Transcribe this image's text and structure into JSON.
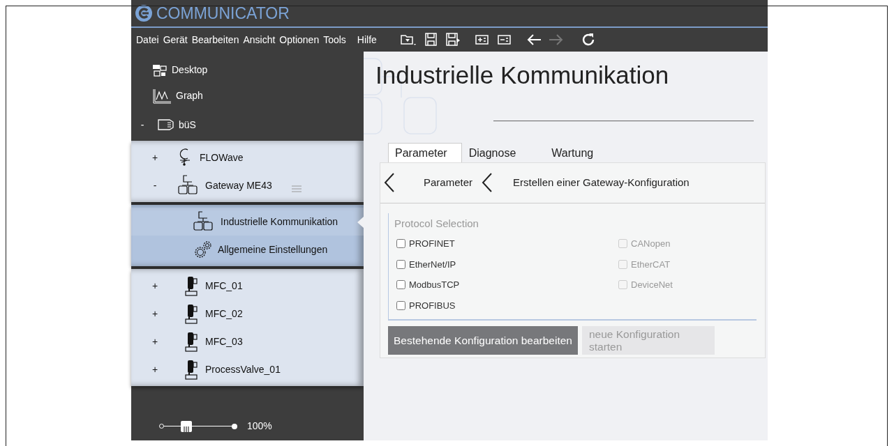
{
  "app": {
    "title": "COMMUNICATOR"
  },
  "menu": [
    {
      "label": "Datei"
    },
    {
      "label": "Gerät"
    },
    {
      "label": "Bearbeiten"
    },
    {
      "label": "Ansicht"
    },
    {
      "label": "Optionen"
    },
    {
      "label": "Tools"
    },
    {
      "label": "Hilfe"
    }
  ],
  "toolbar": [
    {
      "kind": "open",
      "disabled": false
    },
    {
      "kind": "save",
      "disabled": false
    },
    {
      "kind": "save-as",
      "disabled": false
    },
    {
      "kind": "add",
      "disabled": false
    },
    {
      "kind": "remove",
      "disabled": false
    },
    {
      "kind": "back",
      "disabled": false
    },
    {
      "kind": "forward",
      "disabled": true
    },
    {
      "kind": "refresh",
      "disabled": false
    }
  ],
  "sidebar": {
    "nav": [
      {
        "label": "Desktop",
        "kind": "desktop"
      },
      {
        "label": "Graph",
        "kind": "graph"
      }
    ],
    "tree": {
      "label": "büS",
      "kind": "bus",
      "toggle": "-",
      "children": [
        {
          "label": "FLOWave",
          "kind": "flow",
          "toggle": "+"
        },
        {
          "label": "Gateway ME43",
          "kind": "gateway",
          "toggle": "-",
          "menu": true,
          "children": [
            {
              "label": "Industrielle Kommunikation",
              "kind": "gateway",
              "selected": true
            },
            {
              "label": "Allgemeine Einstellungen",
              "kind": "settings",
              "selected": false
            }
          ]
        },
        {
          "label": "MFC_01",
          "kind": "valve",
          "toggle": "+"
        },
        {
          "label": "MFC_02",
          "kind": "valve",
          "toggle": "+"
        },
        {
          "label": "MFC_03",
          "kind": "valve",
          "toggle": "+"
        },
        {
          "label": "ProcessValve_01",
          "kind": "valve",
          "toggle": "+"
        }
      ]
    },
    "zoom": {
      "level": 0.35,
      "reading": "100%"
    }
  },
  "content": {
    "title": "Industrielle Kommunikation",
    "tabs": [
      {
        "label": "Parameter",
        "selected": true
      },
      {
        "label": "Diagnose",
        "selected": false
      },
      {
        "label": "Wartung",
        "selected": false
      }
    ],
    "breadcrumb": [
      "Parameter",
      "Erstellen einer Gateway-Konfiguration"
    ],
    "protocol_selection": {
      "legend": "Protocol Selection",
      "options": [
        {
          "label": "PROFINET",
          "checked": false,
          "disabled": false
        },
        {
          "label": "CANopen",
          "checked": false,
          "disabled": true
        },
        {
          "label": "EtherNet/IP",
          "checked": false,
          "disabled": false
        },
        {
          "label": "EtherCAT",
          "checked": false,
          "disabled": true
        },
        {
          "label": "ModbusTCP",
          "checked": false,
          "disabled": false
        },
        {
          "label": "DeviceNet",
          "checked": false,
          "disabled": true
        },
        {
          "label": "PROFIBUS",
          "checked": false,
          "disabled": false
        }
      ]
    },
    "buttons": [
      {
        "label": "Bestehende Konfiguration bearbeiten",
        "disabled": false
      },
      {
        "label": "neue Konfiguration starten",
        "disabled": true
      }
    ]
  }
}
